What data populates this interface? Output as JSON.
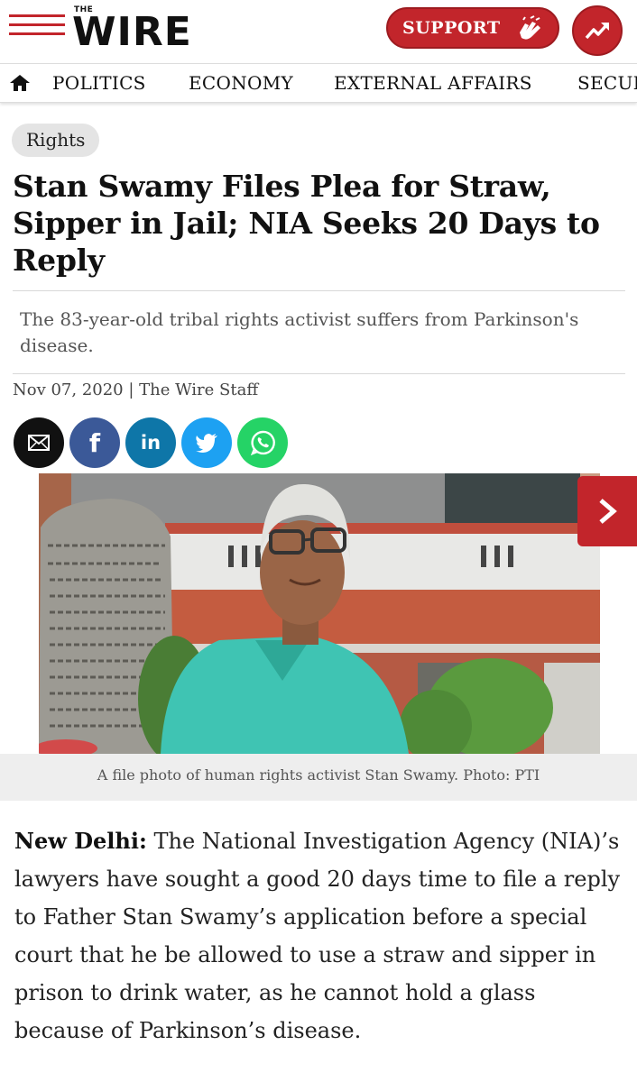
{
  "brand": {
    "small": "THE",
    "name": "WIRE",
    "accent": "#c2252b"
  },
  "header": {
    "support_label": "SUPPORT"
  },
  "nav": {
    "items": [
      "POLITICS",
      "ECONOMY",
      "EXTERNAL AFFAIRS",
      "SECUR"
    ]
  },
  "article": {
    "category": "Rights",
    "headline": "Stan Swamy Files Plea for Straw, Sipper in Jail; NIA Seeks 20 Days to Reply",
    "subhead": "The 83-year-old tribal rights activist suffers from Parkinson's disease.",
    "byline": "Nov 07, 2020 | The Wire Staff",
    "caption": "A file photo of human rights activist Stan Swamy. Photo: PTI",
    "dateline": "New Delhi:",
    "body": "The National Investigation Agency (NIA)’s lawyers have sought a good 20 days time to file a reply to Father Stan Swamy’s application before a special court that he be allowed to use a straw and sipper in prison to drink water, as he cannot hold a glass because of Parkinson’s disease."
  },
  "share": {
    "email": "email-icon",
    "facebook": "f",
    "linkedin": "in",
    "twitter": "twitter-icon",
    "whatsapp": "whatsapp-icon"
  }
}
